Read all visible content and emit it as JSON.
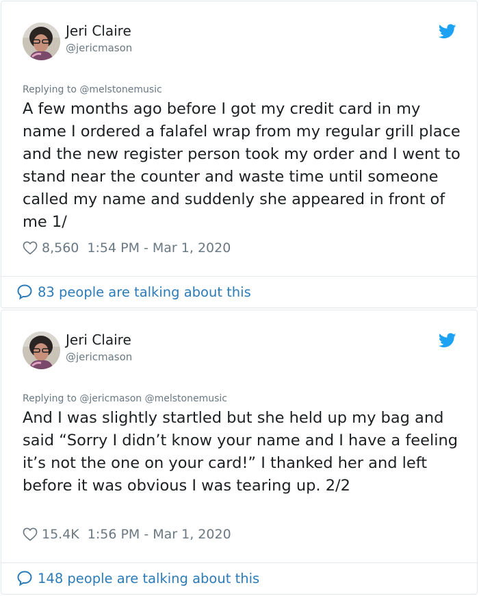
{
  "tweets": [
    {
      "author_name": "Jeri Claire",
      "author_handle": "@jericmason",
      "replying_to": "Replying to @melstonemusic",
      "text": "A few months ago before I got my credit card in my name I ordered a falafel wrap from my regular grill place and the new register person took my order and I went to stand near the counter and waste time until someone called my name and suddenly she appeared in front of me 1/",
      "likes": "8,560",
      "timestamp": "1:54 PM - Mar 1, 2020",
      "talking": "83 people are talking about this"
    },
    {
      "author_name": "Jeri Claire",
      "author_handle": "@jericmason",
      "replying_to": "Replying to @jericmason @melstonemusic",
      "text": "And I was slightly startled but she held up my bag and said “Sorry I didn’t know your name and I have a feeling it’s not the one on your card!” I thanked her and left before it was obvious I was tearing up. 2/2",
      "likes": "15.4K",
      "timestamp": "1:56 PM - Mar 1, 2020",
      "talking": "148 people are talking about this"
    }
  ],
  "icons": {
    "brand": "twitter-bird-icon",
    "like": "heart-icon",
    "conversation": "speech-bubble-icon",
    "avatar": "avatar"
  },
  "colors": {
    "twitter_blue": "#1da1f2",
    "link_blue": "#2b7bb9",
    "secondary_text": "#697882",
    "border": "#e1e8ed"
  }
}
